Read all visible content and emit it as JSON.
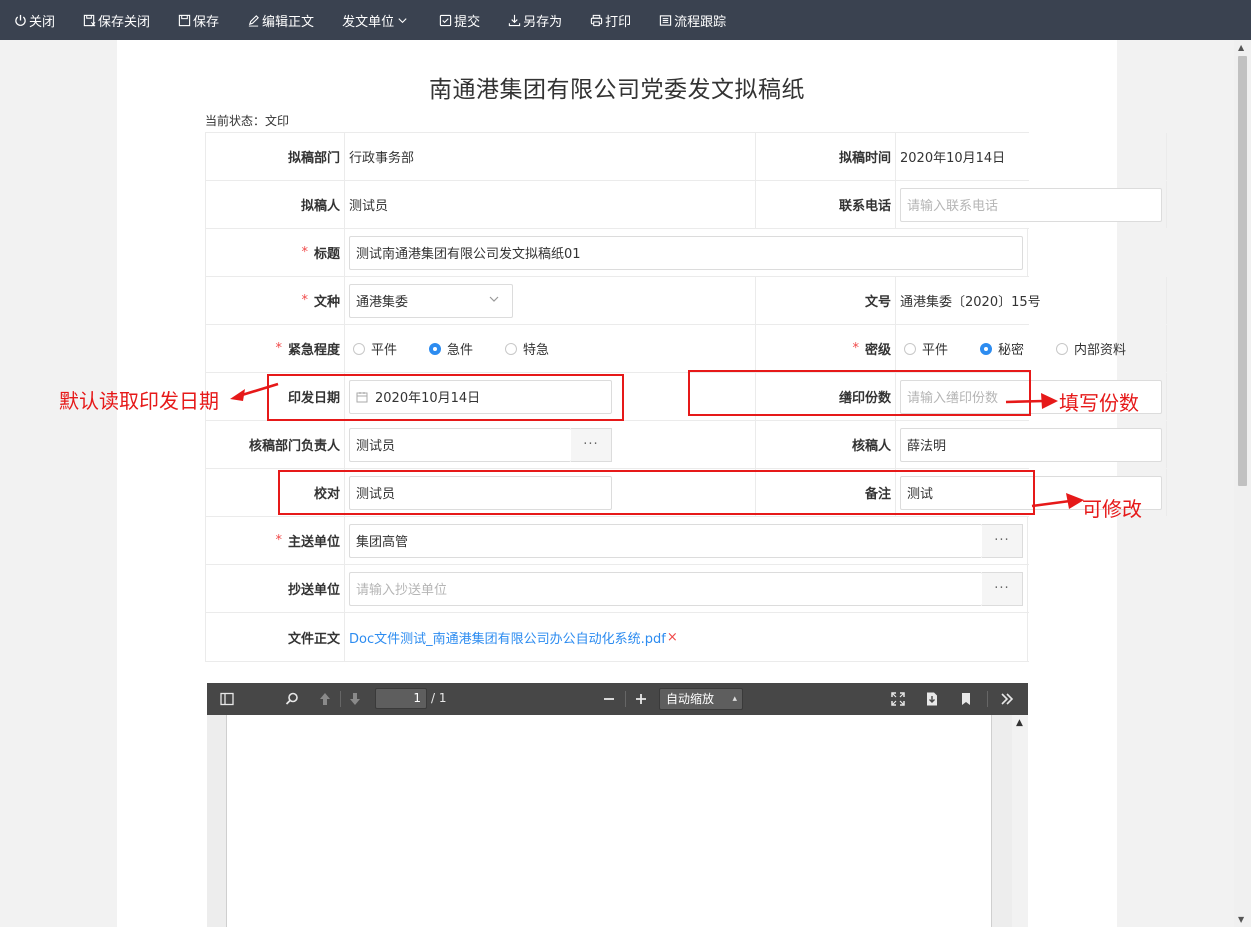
{
  "toolbar": {
    "items": [
      {
        "label": "关闭",
        "icon": "power-icon"
      },
      {
        "label": "保存关闭",
        "icon": "save-close-icon"
      },
      {
        "label": "保存",
        "icon": "save-icon"
      },
      {
        "label": "编辑正文",
        "icon": "edit-icon"
      },
      {
        "label": "发文单位",
        "icon": "chevron-down-icon"
      },
      {
        "label": "提交",
        "icon": "check-icon"
      },
      {
        "label": "另存为",
        "icon": "download-icon"
      },
      {
        "label": "打印",
        "icon": "print-icon"
      },
      {
        "label": "流程跟踪",
        "icon": "list-icon"
      }
    ]
  },
  "doc": {
    "title": "南通港集团有限公司党委发文拟稿纸",
    "status": "当前状态：文印"
  },
  "form": {
    "draft_dept_label": "拟稿部门",
    "draft_dept": "行政事务部",
    "draft_time_label": "拟稿时间",
    "draft_time": "2020年10月14日",
    "drafter_label": "拟稿人",
    "drafter": "测试员",
    "phone_label": "联系电话",
    "phone_placeholder": "请输入联系电话",
    "title_label": "标题",
    "title_value": "测试南通港集团有限公司发文拟稿纸01",
    "doc_type_label": "文种",
    "doc_type": "通港集委",
    "doc_no_label": "文号",
    "doc_no": "通港集委〔2020〕15号",
    "urgency_label": "紧急程度",
    "urgency_options": [
      "平件",
      "急件",
      "特急"
    ],
    "urgency_selected": "急件",
    "secret_label": "密级",
    "secret_options": [
      "平件",
      "秘密",
      "内部资料"
    ],
    "secret_selected": "秘密",
    "print_date_label": "印发日期",
    "print_date": "2020年10月14日",
    "copies_label": "缮印份数",
    "copies_placeholder": "请输入缮印份数",
    "reviewer_head_label": "核稿部门负责人",
    "reviewer_head": "测试员",
    "checker_label": "核稿人",
    "checker": "薛法明",
    "proof_label": "校对",
    "proof": "测试员",
    "remark_label": "备注",
    "remark": "测试",
    "main_recipient_label": "主送单位",
    "main_recipient": "集团高管",
    "cc_label": "抄送单位",
    "cc_placeholder": "请输入抄送单位",
    "body_file_label": "文件正文",
    "body_file": "Doc文件测试_南通港集团有限公司办公自动化系统.pdf",
    "dots": "···",
    "remove_mark": "×"
  },
  "pdf": {
    "page": "1",
    "total": "/ 1",
    "zoom": "自动缩放"
  },
  "annotations": {
    "left": "默认读取印发日期",
    "right_copies": "填写份数",
    "right_edit": "可修改",
    "color": "#e61919"
  }
}
